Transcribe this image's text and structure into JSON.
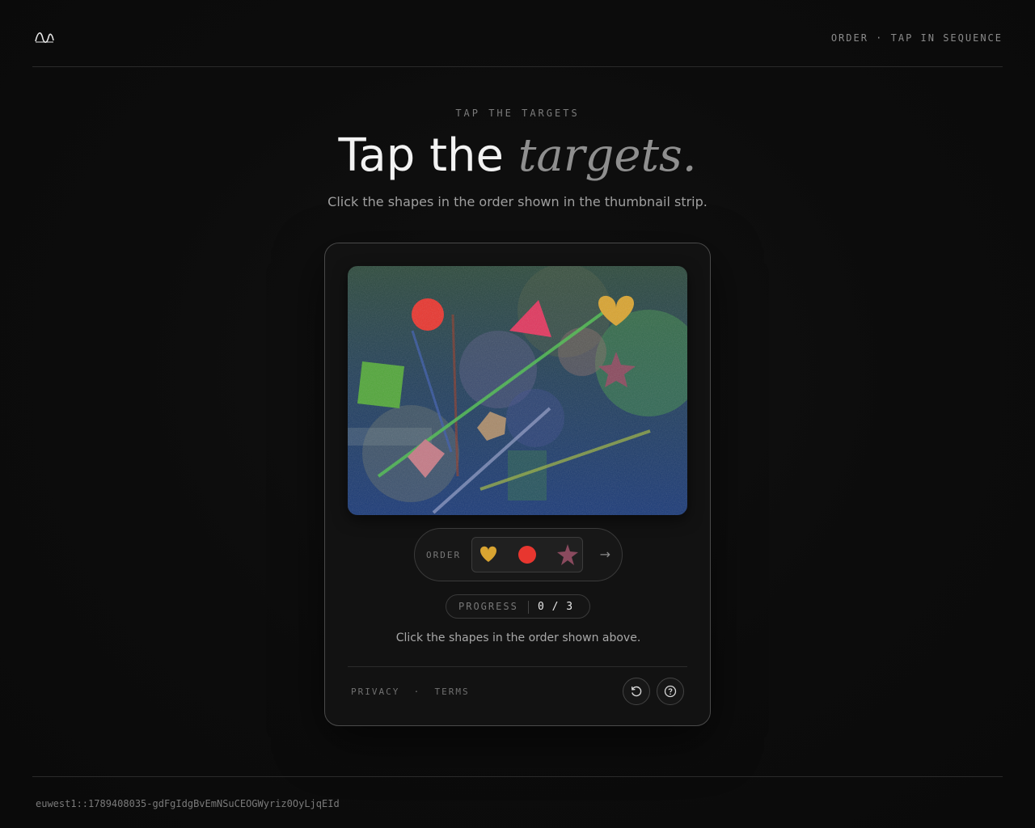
{
  "header": {
    "logo_icon": "wave-logo-icon",
    "mode_label": "ORDER · TAP IN SEQUENCE"
  },
  "hero": {
    "eyebrow": "TAP THE TARGETS",
    "title_plain": "Tap the",
    "title_emphasis": "targets.",
    "subtitle": "Click the shapes in the order shown in the thumbnail strip."
  },
  "challenge": {
    "canvas_shapes": [
      "heart",
      "triangle",
      "circle",
      "square",
      "star",
      "pentagon",
      "diamond"
    ],
    "order": {
      "label": "ORDER",
      "sequence": [
        {
          "shape": "heart",
          "icon": "heart-icon",
          "color": "#d9a431"
        },
        {
          "shape": "circle",
          "icon": "circle-icon",
          "color": "#e8362f"
        },
        {
          "shape": "star",
          "icon": "star-icon",
          "color": "#8a4a5e"
        }
      ],
      "arrow": "→"
    },
    "progress": {
      "label": "PROGRESS",
      "value": "0 / 3",
      "current": 0,
      "total": 3
    },
    "instruction": "Click the shapes in the order shown above.",
    "links": {
      "privacy": "PRIVACY",
      "separator": "·",
      "terms": "TERMS"
    },
    "buttons": {
      "refresh_icon": "refresh-icon",
      "help_icon": "help-icon"
    }
  },
  "footer": {
    "session_id": "euwest1::1789408035-gdFgIdgBvEmNSuCEOGWyriz0OyLjqEId"
  },
  "colors": {
    "background": "#0b0b0b",
    "card_border": "#4a4a4a",
    "accent_text": "#f2f2f2",
    "muted_text": "#8f8f8f"
  }
}
